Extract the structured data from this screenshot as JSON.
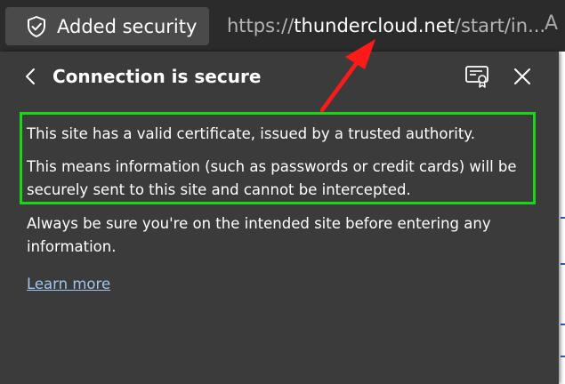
{
  "address_bar": {
    "security_label": "Added security",
    "url_prefix": "https://",
    "url_host": "thundercloud.net",
    "url_path": "/start/in...",
    "read_aloud_glyph": "A"
  },
  "popup": {
    "title": "Connection is secure",
    "para_valid": "This site has a valid certificate, issued by a trusted authority.",
    "para_means": "This means information (such as passwords or credit cards) will be securely sent to this site and cannot be intercepted.",
    "para_always": "Always be sure you're on the intended site before entering any information.",
    "learn_more": "Learn more"
  },
  "icons": {
    "shield": "shield-check-icon",
    "back": "chevron-left-icon",
    "certificate": "certificate-icon",
    "close": "close-icon"
  },
  "colors": {
    "highlight": "#18d815",
    "annotation_arrow": "#ff1a1a",
    "link": "#9fc6ee"
  }
}
